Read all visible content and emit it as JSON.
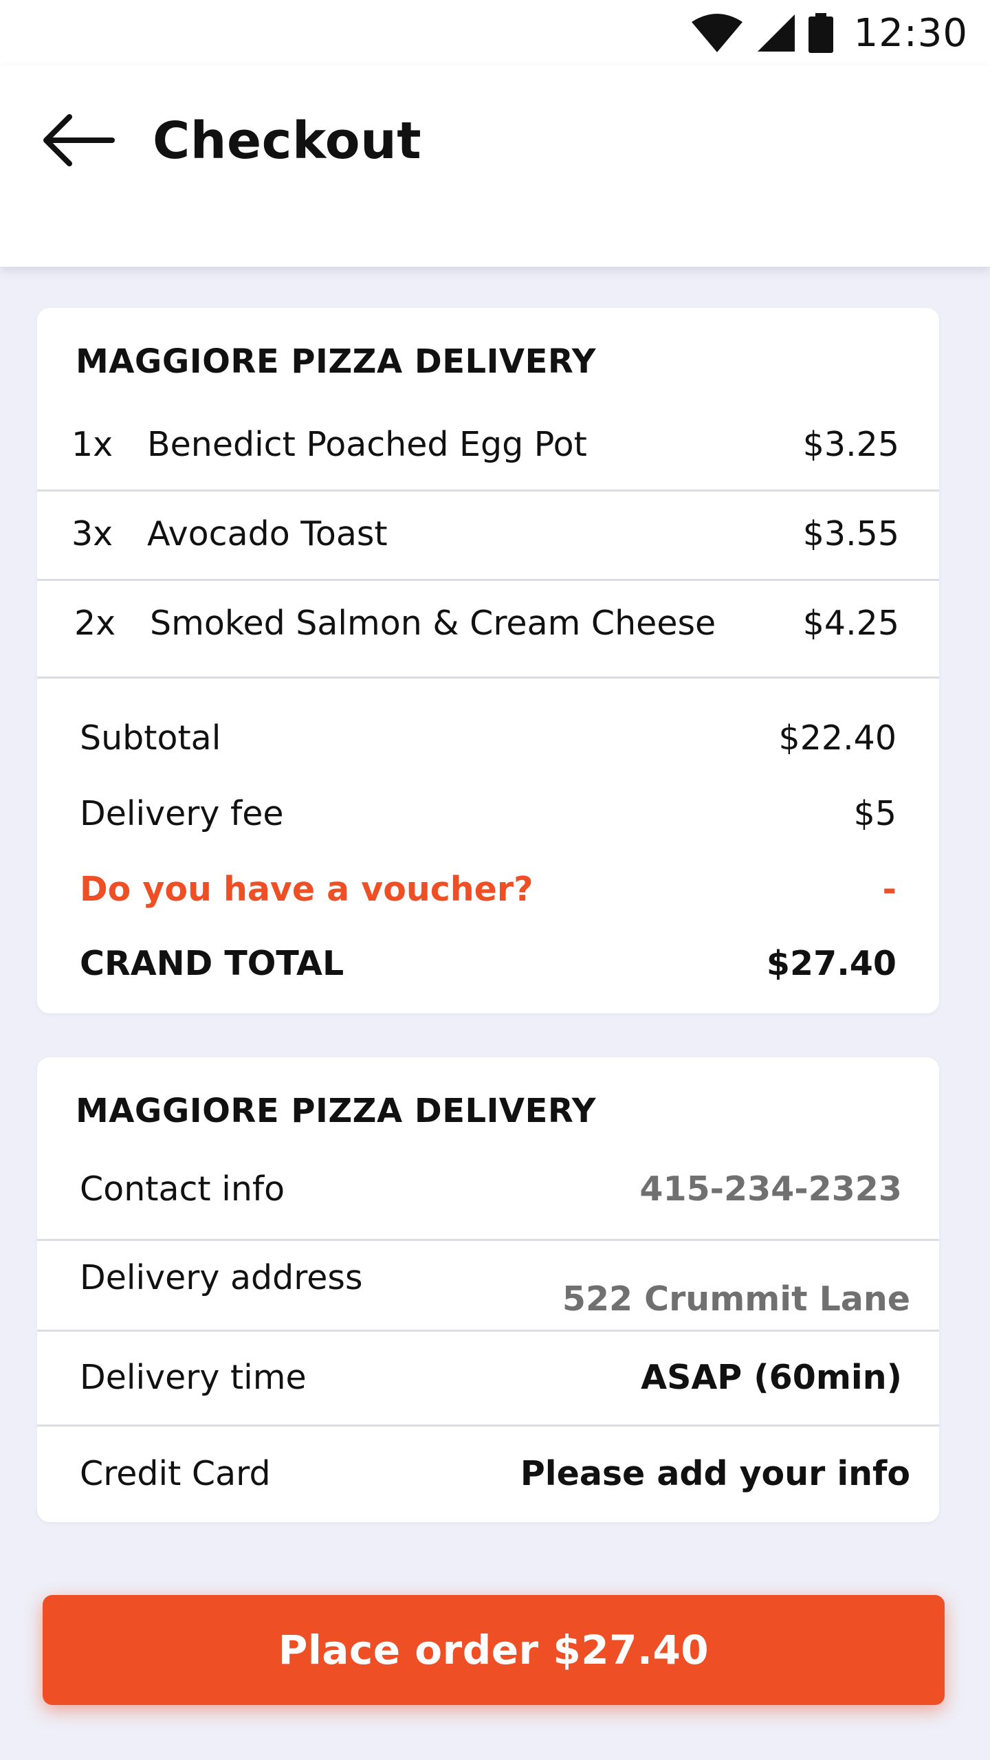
{
  "status_bar": {
    "time": "12:30",
    "icons": [
      "wifi-icon",
      "cellular-signal-icon",
      "battery-icon"
    ]
  },
  "header": {
    "back_icon": "arrow-left-icon",
    "title": "Checkout"
  },
  "order_card": {
    "restaurant": "MAGGIORE PIZZA DELIVERY",
    "items": [
      {
        "qty": "1x",
        "name": "Benedict Poached Egg Pot",
        "price": "$3.25"
      },
      {
        "qty": "3x",
        "name": "Avocado Toast",
        "price": "$3.55"
      },
      {
        "qty": "2x",
        "name": "Smoked Salmon & Cream Cheese",
        "price": "$4.25"
      }
    ],
    "subtotal": {
      "label": "Subtotal",
      "value": "$22.40"
    },
    "delivery_fee": {
      "label": "Delivery fee",
      "value": "$5"
    },
    "voucher": {
      "label": "Do you have a voucher?",
      "value": "-"
    },
    "grand_total": {
      "label": "CRAND TOTAL",
      "value": "$27.40"
    }
  },
  "info_card": {
    "restaurant": "MAGGIORE PIZZA DELIVERY",
    "contact": {
      "label": "Contact info",
      "value": "415-234-2323"
    },
    "address": {
      "label": "Delivery address",
      "value": "522 Crummit Lane"
    },
    "time": {
      "label": "Delivery time",
      "value": "ASAP (60min)"
    },
    "card": {
      "label": "Credit Card",
      "value": "Please add your info"
    }
  },
  "place_order": {
    "label": "Place order $27.40"
  },
  "colors": {
    "accent": "#ee4f24",
    "background": "#eeeff8",
    "card": "#ffffff",
    "muted_text": "#707070"
  }
}
